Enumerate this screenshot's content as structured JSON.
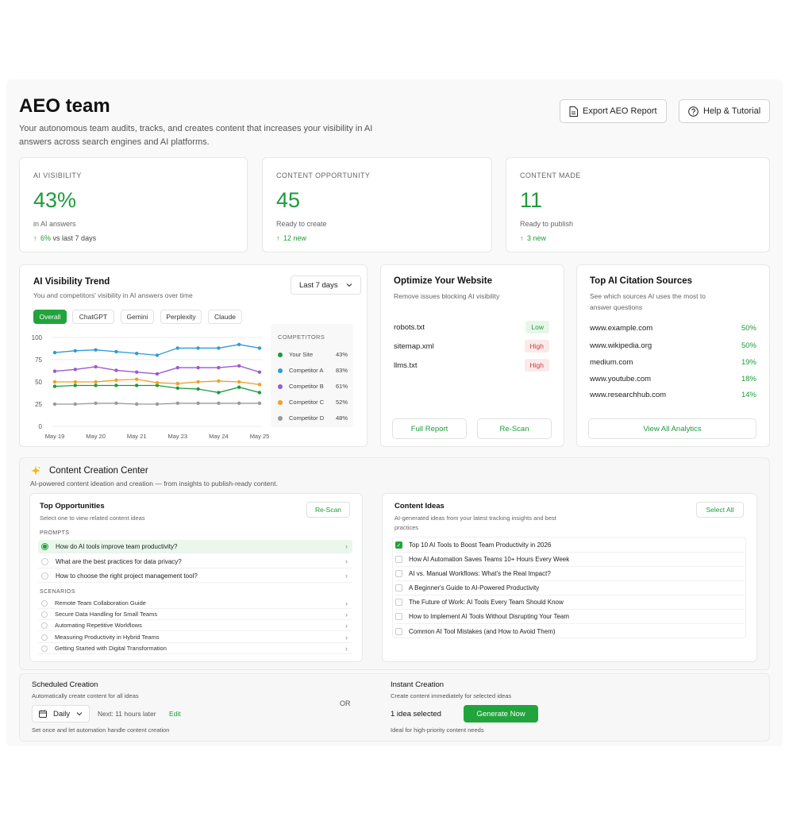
{
  "header": {
    "title": "AEO team",
    "subtitle": "Your autonomous team audits, tracks, and creates content that increases your visibility in AI answers across search engines and AI platforms.",
    "export_label": "Export AEO Report",
    "help_label": "Help & Tutorial"
  },
  "stats": [
    {
      "label": "AI VISIBILITY",
      "value": "43%",
      "sub": "in AI answers",
      "delta_arrow": "↑",
      "delta_value": "6%",
      "delta_rest": "vs last 7 days"
    },
    {
      "label": "CONTENT OPPORTUNITY",
      "value": "45",
      "sub": "Ready to create",
      "delta_arrow": "↑",
      "delta_value": "12 new",
      "delta_rest": ""
    },
    {
      "label": "CONTENT MADE",
      "value": "11",
      "sub": "Ready to publish",
      "delta_arrow": "↑",
      "delta_value": "3 new",
      "delta_rest": ""
    }
  ],
  "trend": {
    "title": "AI Visibility Trend",
    "desc": "You and competitors' visibility in AI answers over time",
    "period": "Last 7 days",
    "tabs": [
      "Overall",
      "ChatGPT",
      "Gemini",
      "Perplexity",
      "Claude"
    ],
    "legend_title": "COMPETITORS"
  },
  "chart_data": {
    "type": "line",
    "x": [
      "May 19",
      "",
      "May 20",
      "",
      "May 21",
      "",
      "May 23",
      "",
      "May 24",
      "",
      "May 25"
    ],
    "xticks": [
      "May 19",
      "May 20",
      "May 21",
      "May 23",
      "May 24",
      "May 25"
    ],
    "yticks": [
      "100",
      "75",
      "50",
      "25",
      "0"
    ],
    "ylim": [
      0,
      100
    ],
    "series": [
      {
        "name": "Your Site",
        "legend_value": "43%",
        "color": "#1e9b3b",
        "values": [
          45,
          46,
          46,
          46,
          46,
          46,
          43,
          42,
          38,
          44,
          38
        ]
      },
      {
        "name": "Competitor A",
        "legend_value": "83%",
        "color": "#2f9bd6",
        "values": [
          83,
          85,
          86,
          84,
          82,
          80,
          88,
          88,
          88,
          92,
          88
        ]
      },
      {
        "name": "Competitor B",
        "legend_value": "61%",
        "color": "#9b59d0",
        "values": [
          62,
          64,
          67,
          63,
          61,
          59,
          66,
          66,
          66,
          68,
          61
        ]
      },
      {
        "name": "Competitor C",
        "legend_value": "52%",
        "color": "#f0a020",
        "values": [
          50,
          50,
          50,
          52,
          53,
          49,
          48,
          50,
          51,
          50,
          47
        ]
      },
      {
        "name": "Competitor D",
        "legend_value": "48%",
        "color": "#999999",
        "values": [
          25,
          25,
          26,
          26,
          25,
          25,
          26,
          26,
          26,
          26,
          26
        ]
      }
    ]
  },
  "optimize": {
    "title": "Optimize Your Website",
    "desc": "Remove issues blocking AI visibility",
    "issues": [
      {
        "name": "robots.txt",
        "level": "Low",
        "kind": "low"
      },
      {
        "name": "sitemap.xml",
        "level": "High",
        "kind": "high"
      },
      {
        "name": "llms.txt",
        "level": "High",
        "kind": "high"
      }
    ],
    "full_report": "Full Report",
    "rescan": "Re-Scan"
  },
  "citations": {
    "title": "Top AI Citation Sources",
    "desc": "See which sources AI uses the most to answer questions",
    "sources": [
      {
        "domain": "www.example.com",
        "pct": "50%"
      },
      {
        "domain": "www.wikipedia.org",
        "pct": "50%"
      },
      {
        "domain": "medium.com",
        "pct": "19%"
      },
      {
        "domain": "www.youtube.com",
        "pct": "18%"
      },
      {
        "domain": "www.researchhub.com",
        "pct": "14%"
      }
    ],
    "view_all": "View All Analytics"
  },
  "creation": {
    "title": "Content Creation Center",
    "desc": "AI-powered content ideation and creation — from insights to publish-ready content.",
    "opportunities": {
      "title": "Top Opportunities",
      "desc": "Select one to view related content ideas",
      "rescan": "Re-Scan",
      "prompts_label": "PROMPTS",
      "prompts": [
        "How do AI tools improve team productivity?",
        "What are the best practices for data privacy?",
        "How to choose the right project management tool?"
      ],
      "scenarios_label": "SCENARIOS",
      "scenarios": [
        "Remote Team Collaboration Guide",
        "Secure Data Handling for Small Teams",
        "Automating Repetitive Workflows",
        "Measuring Productivity in Hybrid Teams",
        "Getting Started with Digital Transformation"
      ]
    },
    "ideas": {
      "title": "Content Ideas",
      "desc": "AI-generated ideas from your latest tracking insights and best practices",
      "select_all": "Select All",
      "items": [
        "Top 10 AI Tools to Boost Team Productivity in 2026",
        "How AI Automation Saves Teams 10+ Hours Every Week",
        "AI vs. Manual Workflows: What's the Real Impact?",
        "A Beginner's Guide to AI-Powered Productivity",
        "The Future of Work: AI Tools Every Team Should Know",
        "How to Implement AI Tools Without Disrupting Your Team",
        "Common AI Tool Mistakes (and How to Avoid Them)"
      ]
    }
  },
  "scheduled": {
    "title": "Scheduled Creation",
    "desc": "Automatically create content for all ideas",
    "frequency": "Daily",
    "next_label": "Next: 11 hours later",
    "edit": "Edit",
    "note": "Set once and let automation handle content creation"
  },
  "or_label": "OR",
  "instant": {
    "title": "Instant Creation",
    "desc": "Create content immediately for selected ideas",
    "selected": "1 idea selected",
    "generate": "Generate Now",
    "note": "Ideal for high-priority content needs"
  }
}
